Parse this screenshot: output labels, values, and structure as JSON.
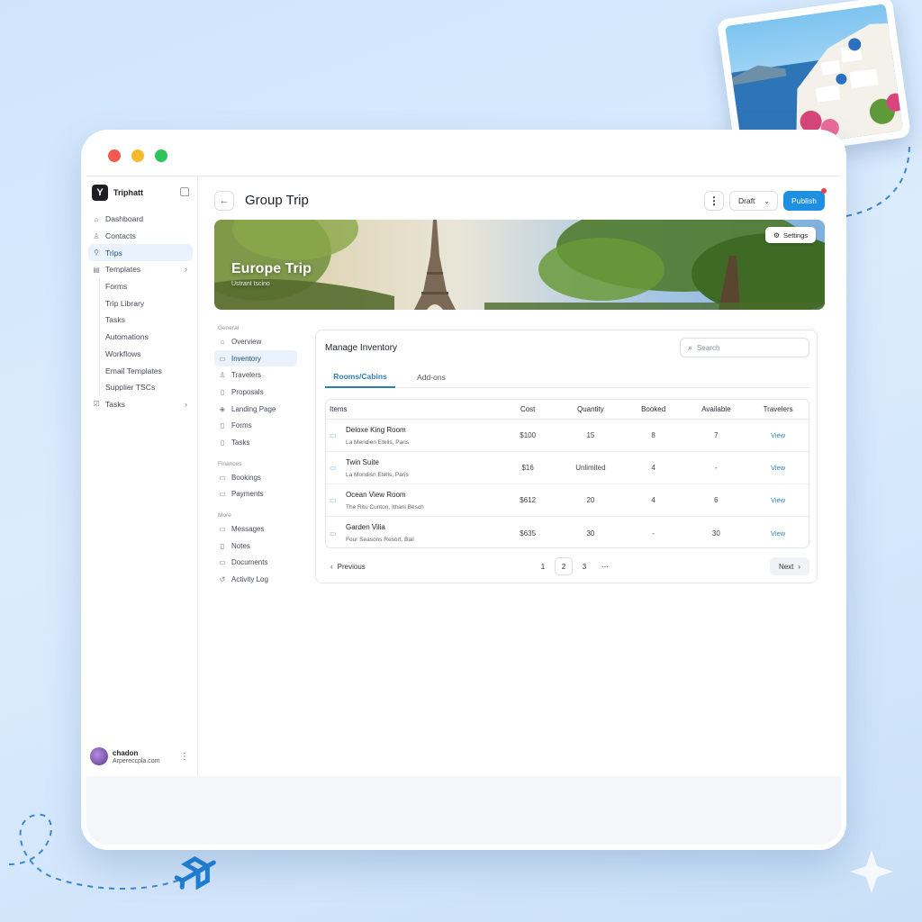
{
  "app": {
    "brand": "Triphatt",
    "brand_logo": "Y",
    "user_name": "chadon",
    "user_email": "Arpereccpla.com"
  },
  "sidebar": {
    "items": [
      {
        "label": "Dashboard",
        "icon": "home-icon"
      },
      {
        "label": "Contacts",
        "icon": "user-icon"
      },
      {
        "label": "Trips",
        "icon": "trips-icon",
        "active": true
      },
      {
        "label": "Templates",
        "icon": "templates-icon",
        "expandable": true
      }
    ],
    "template_subitems": [
      "Forms",
      "Trip Library",
      "Tasks",
      "Automations",
      "Workflows",
      "Email Templates",
      "Supplier TSCs"
    ],
    "tasks_label": "Tasks"
  },
  "header": {
    "title": "Group Trip",
    "draft_label": "Draft",
    "publish_label": "Publish"
  },
  "banner": {
    "title": "Europe Trip",
    "subtitle": "Ustrant tscino",
    "settings_label": "Settings"
  },
  "subnav": {
    "general_heading": "General",
    "general": [
      "Overview",
      "Inventory",
      "Travelers",
      "Proposals",
      "Landing Page",
      "Forms",
      "Tasks"
    ],
    "finances_heading": "Finances",
    "finances": [
      "Bookings",
      "Payments"
    ],
    "more_heading": "More",
    "more": [
      "Messages",
      "Notes",
      "Documents",
      "Activity Log"
    ]
  },
  "inventory": {
    "title": "Manage Inventory",
    "search_placeholder": "Search",
    "tabs": [
      "Rooms/Cabins",
      "Add-ons"
    ],
    "columns": [
      "Items",
      "Cost",
      "Quantity",
      "Booked",
      "Available",
      "Travelers"
    ],
    "rows": [
      {
        "name": "Deloxe King Room",
        "location": "La Mendien Etells, Paris",
        "cost": "$100",
        "quantity": "15",
        "booked": "8",
        "available": "7",
        "travelers": "View"
      },
      {
        "name": "Twin Suite",
        "location": "La Mondisn Etells, Paris",
        "cost": "$16",
        "quantity": "Unlimited",
        "booked": "4",
        "available": "-",
        "travelers": "View"
      },
      {
        "name": "Ocean View Room",
        "location": "The Ritu Cunton, Ithani Besch",
        "cost": "$612",
        "quantity": "20",
        "booked": "4",
        "available": "6",
        "travelers": "View"
      },
      {
        "name": "Garden Vilia",
        "location": "Four Seasons Resort, Bail",
        "cost": "$635",
        "quantity": "30",
        "booked": "-",
        "available": "30",
        "travelers": "View"
      }
    ],
    "pagination": {
      "prev": "Previous",
      "pages": [
        "1",
        "2",
        "3",
        "···"
      ],
      "current": "2",
      "next": "Next"
    }
  },
  "colors": {
    "accent": "#1f8fe0",
    "tab_active": "#2c7fae",
    "link": "#2a86c7"
  }
}
